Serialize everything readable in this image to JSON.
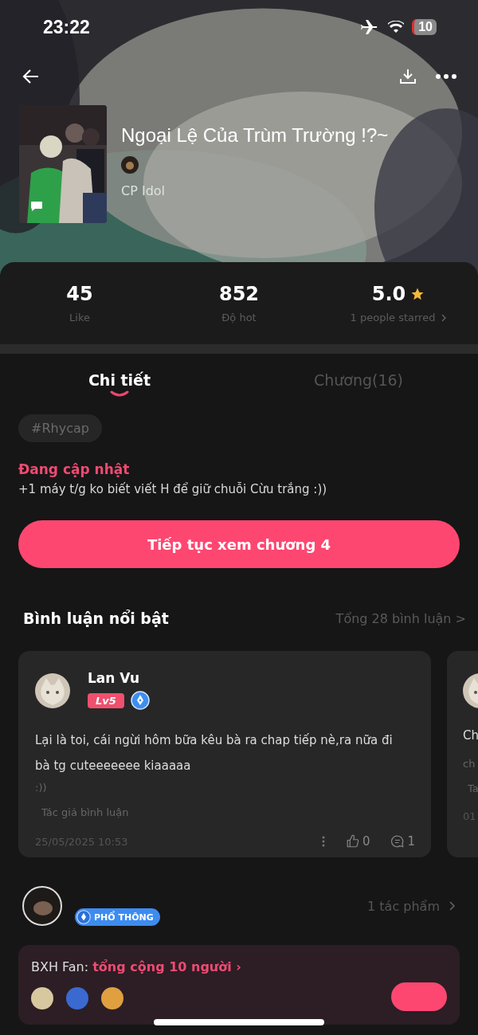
{
  "status_bar": {
    "time": "23:22",
    "battery": "10"
  },
  "book": {
    "title": "Ngoại Lệ Của Trùm Trường !?~",
    "category": "CP Idol"
  },
  "stats": [
    {
      "value": "45",
      "label": "Like",
      "kind": "plain"
    },
    {
      "value": "852",
      "label": "Độ hot",
      "kind": "plain"
    },
    {
      "value": "5.0",
      "label": "1 people starred",
      "kind": "rating"
    }
  ],
  "tabs": [
    {
      "label": "Chi tiết",
      "selected": true
    },
    {
      "label": "Chương(16)",
      "selected": false
    }
  ],
  "tags": [
    "#Rhycap"
  ],
  "update": {
    "status": "Đang cập nhật",
    "description": "+1 máy t/g ko biết viết H để giữ chuỗi Cừu trắng :))"
  },
  "continue_button": "Tiếp tục xem chương 4",
  "comments_section": {
    "title": "Bình luận nổi bật",
    "total": "Tổng 28 bình luận >"
  },
  "comments": [
    {
      "user": "Lan Vu",
      "level": "Lv5",
      "text": "Lại là toi, cái ngừi hôm bữa kêu bà ra chap tiếp nè,ra nữa đi bà tg cuteeeeeee kiaaaaa",
      "extra": ":))",
      "tag": "Tác giả bình luận",
      "date": "25/05/2025 10:53",
      "likes": "0",
      "replies": "1"
    },
    {
      "text": "Ch",
      "extra": "ch",
      "tag": "Ta",
      "date": "01"
    }
  ],
  "author": {
    "badge": "PHỔ THÔNG",
    "works": "1 tác phẩm"
  },
  "fans": {
    "label": "BXH Fan: ",
    "total": "tổng cộng 10 người",
    "arrow": "›"
  }
}
